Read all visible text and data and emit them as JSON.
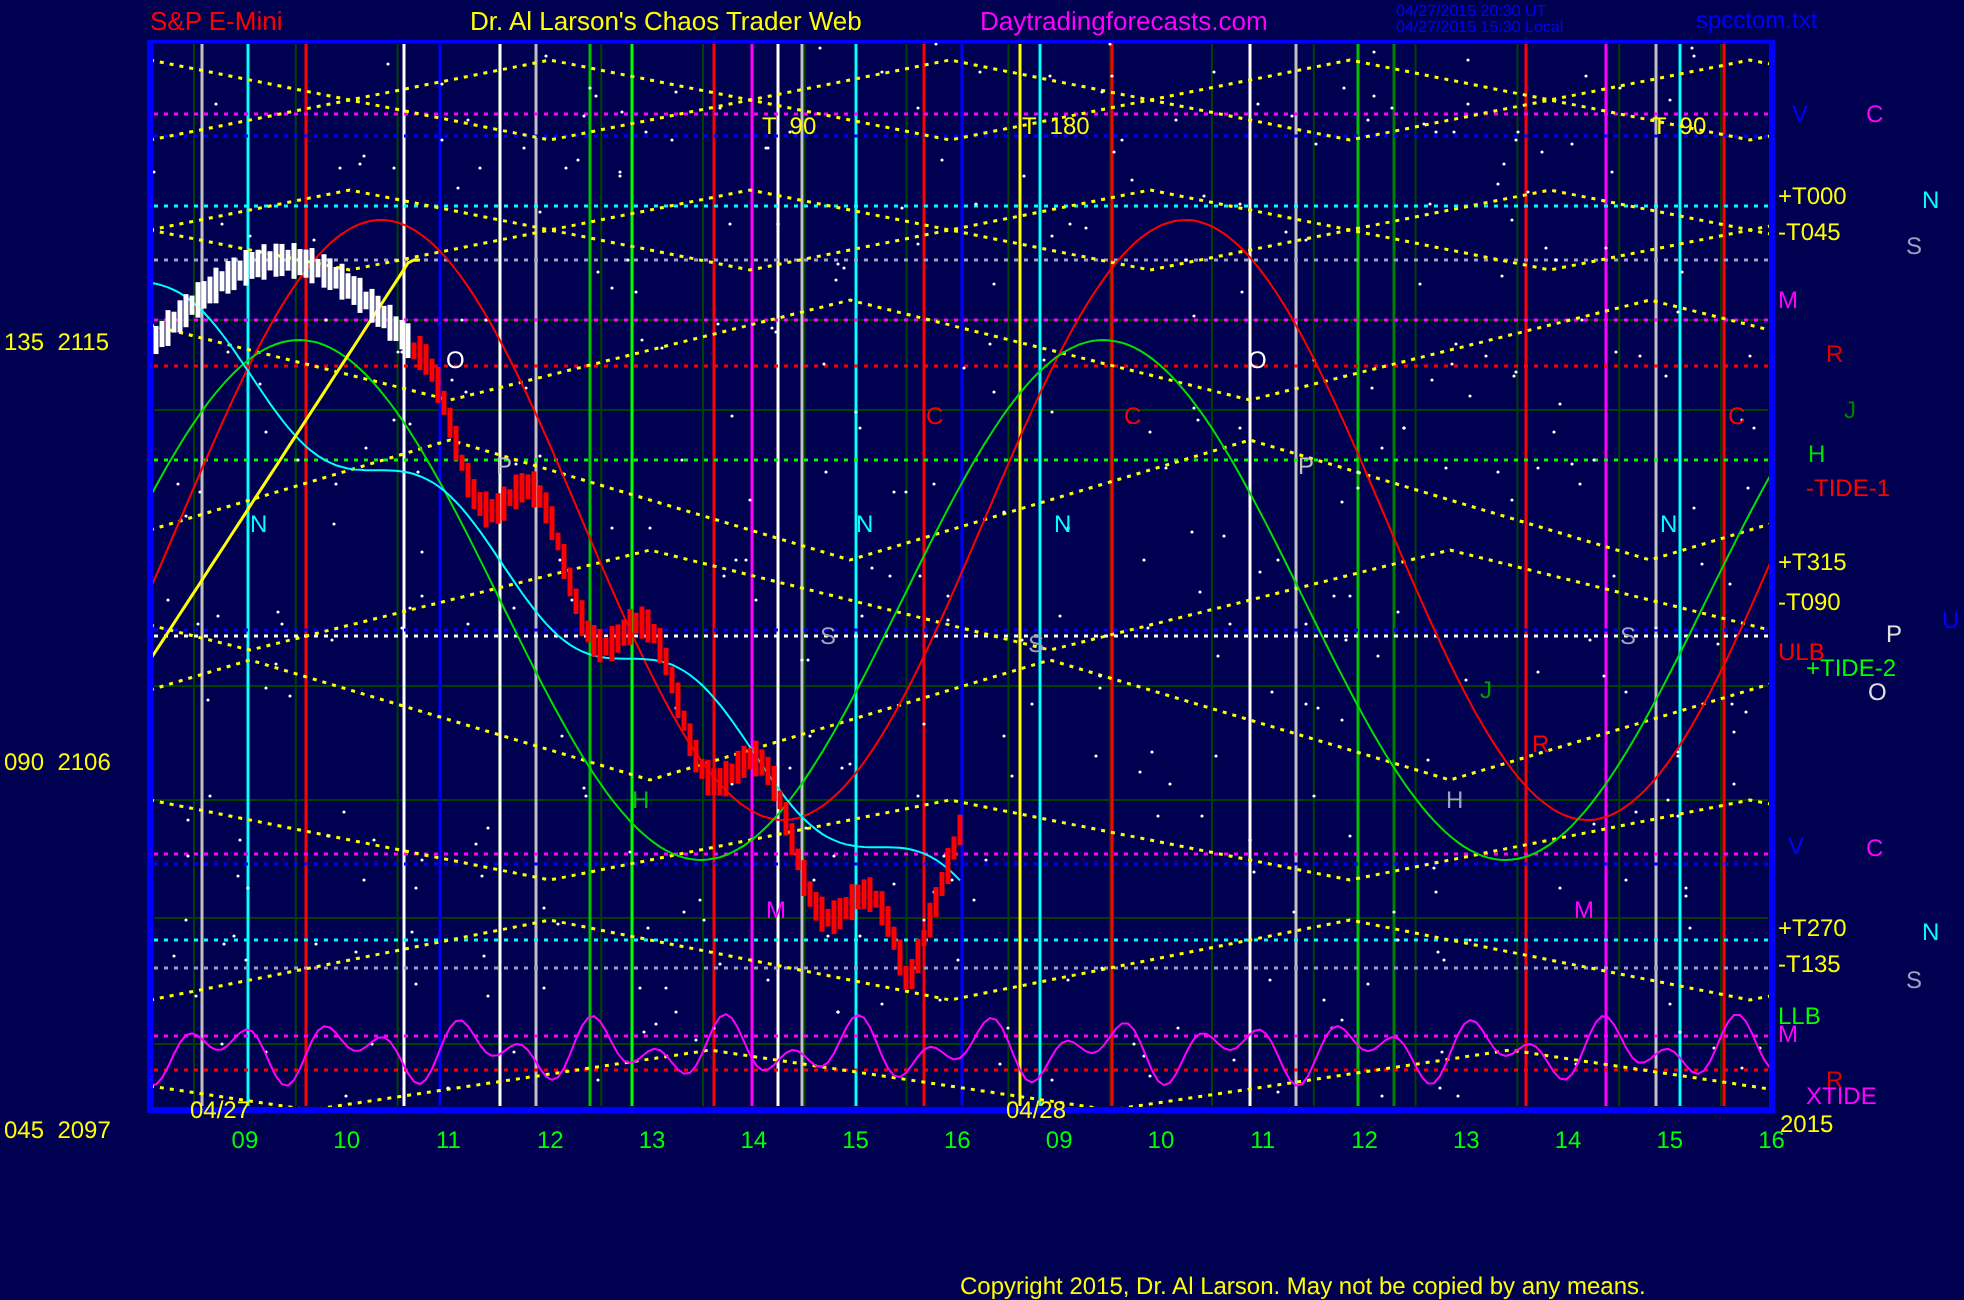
{
  "header": {
    "instrument": "S&P E-Mini",
    "title": "Dr. Al Larson's Chaos Trader Web",
    "site": "Daytradingforecasts.com",
    "timestamps": [
      "04/27/2015 20:30 UT",
      "04/27/2015 15:30 Local"
    ],
    "file": "spcctom.txt"
  },
  "y_axis": [
    {
      "angle": "135",
      "price": "2115"
    },
    {
      "angle": "090",
      "price": "2106"
    },
    {
      "angle": "045",
      "price": "2097"
    }
  ],
  "plot_labels": [
    {
      "text": "T  90",
      "color": "#ffff00"
    },
    {
      "text": "T  180",
      "color": "#ffff00"
    },
    {
      "text": "T  90",
      "color": "#ffff00"
    },
    {
      "text": "04/27",
      "color": "#ffff00"
    },
    {
      "text": "04/28",
      "color": "#ffff00"
    },
    {
      "text": "N",
      "color": "#00ffff"
    },
    {
      "text": "N",
      "color": "#00ffff"
    },
    {
      "text": "N",
      "color": "#00ffff"
    },
    {
      "text": "N",
      "color": "#00ffff"
    },
    {
      "text": "O",
      "color": "#ffffff"
    },
    {
      "text": "O",
      "color": "#ffffff"
    },
    {
      "text": "P",
      "color": "#c0c0c0"
    },
    {
      "text": "P",
      "color": "#c0c0c0"
    },
    {
      "text": "C",
      "color": "#ff0000"
    },
    {
      "text": "C",
      "color": "#ff0000"
    },
    {
      "text": "C",
      "color": "#ff0000"
    },
    {
      "text": "S",
      "color": "#a0a0c0"
    },
    {
      "text": "S",
      "color": "#a0a0c0"
    },
    {
      "text": "S",
      "color": "#a0a0c0"
    },
    {
      "text": "H",
      "color": "#00c000"
    },
    {
      "text": "H",
      "color": "#a0a0c0"
    },
    {
      "text": "J",
      "color": "#00a000"
    },
    {
      "text": "R",
      "color": "#ff0000"
    },
    {
      "text": "M",
      "color": "#ff00ff"
    },
    {
      "text": "M",
      "color": "#ff00ff"
    }
  ],
  "right_labels": [
    {
      "text": "V",
      "color": "#0000ff"
    },
    {
      "text": "C",
      "color": "#ff00ff"
    },
    {
      "text": "+T000",
      "color": "#ffff00"
    },
    {
      "text": "N",
      "color": "#00ffff"
    },
    {
      "text": "-T045",
      "color": "#ffff00"
    },
    {
      "text": "S",
      "color": "#a0a0c0"
    },
    {
      "text": "M",
      "color": "#ff00ff"
    },
    {
      "text": "R",
      "color": "#e00000"
    },
    {
      "text": "J",
      "color": "#008000"
    },
    {
      "text": "H",
      "color": "#00e000"
    },
    {
      "text": "-TIDE-1",
      "color": "#ff0000"
    },
    {
      "text": "+T315",
      "color": "#ffff00"
    },
    {
      "text": "-T090",
      "color": "#ffff00"
    },
    {
      "text": "U",
      "color": "#0000ff"
    },
    {
      "text": "P",
      "color": "#e0e0e0"
    },
    {
      "text": "ULB",
      "color": "#ff0000"
    },
    {
      "text": "+TIDE-2",
      "color": "#00ff00"
    },
    {
      "text": "O",
      "color": "#e0e0e0"
    },
    {
      "text": "V",
      "color": "#0000ff"
    },
    {
      "text": "C",
      "color": "#ff00ff"
    },
    {
      "text": "+T270",
      "color": "#ffff00"
    },
    {
      "text": "N",
      "color": "#00ffff"
    },
    {
      "text": "-T135",
      "color": "#ffff00"
    },
    {
      "text": "S",
      "color": "#a0a0c0"
    },
    {
      "text": "LLB",
      "color": "#00ff00"
    },
    {
      "text": "M",
      "color": "#ff00ff"
    },
    {
      "text": "R",
      "color": "#e00000"
    },
    {
      "text": "XTIDE",
      "color": "#ff00ff"
    },
    {
      "text": "2015",
      "color": "#ffff00"
    }
  ],
  "x_axis": [
    "09",
    "10",
    "11",
    "12",
    "13",
    "14",
    "15",
    "16",
    "09",
    "10",
    "11",
    "12",
    "13",
    "14",
    "15",
    "16"
  ],
  "copyright": "Copyright 2015, Dr. Al Larson. May not be copied by any means."
}
